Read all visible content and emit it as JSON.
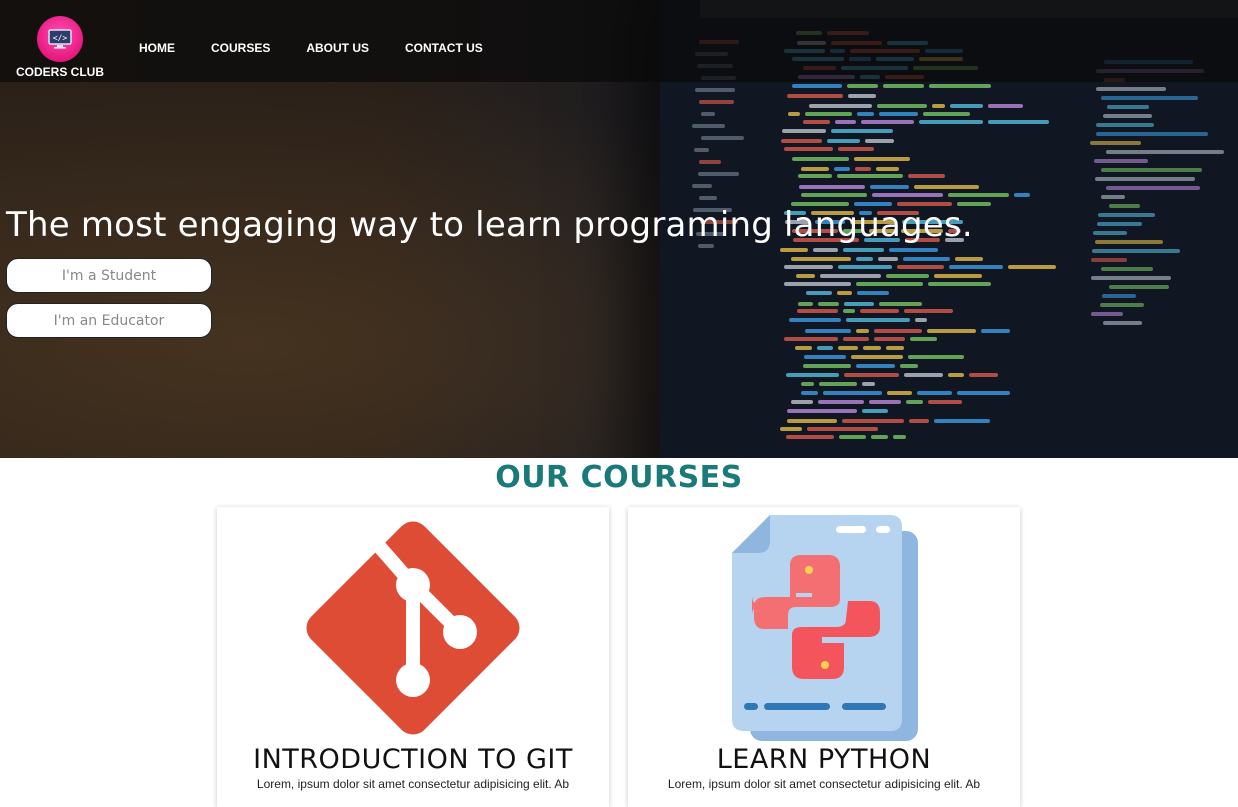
{
  "nav": {
    "brand": "CODERS CLUB",
    "brand_icon": "monitor-code-icon",
    "links": [
      "HOME",
      "COURSES",
      "ABOUT US",
      "CONTACT US"
    ]
  },
  "hero": {
    "title": "The most engaging way to learn programing languages.",
    "buttons": [
      "I'm a Student",
      "I'm an Educator"
    ]
  },
  "courses": {
    "heading": "OUR COURSES",
    "items": [
      {
        "title": "INTRODUCTION TO GIT",
        "text": "Lorem, ipsum dolor sit amet consectetur adipisicing elit. Ab",
        "icon": "git-icon"
      },
      {
        "title": "LEARN PYTHON",
        "text": "Lorem, ipsum dolor sit amet consectetur adipisicing elit. Ab",
        "icon": "python-icon"
      }
    ]
  },
  "colors": {
    "accent": "#1a7a7a",
    "brand_pink": "#e8187f",
    "git_red": "#de4c36"
  }
}
